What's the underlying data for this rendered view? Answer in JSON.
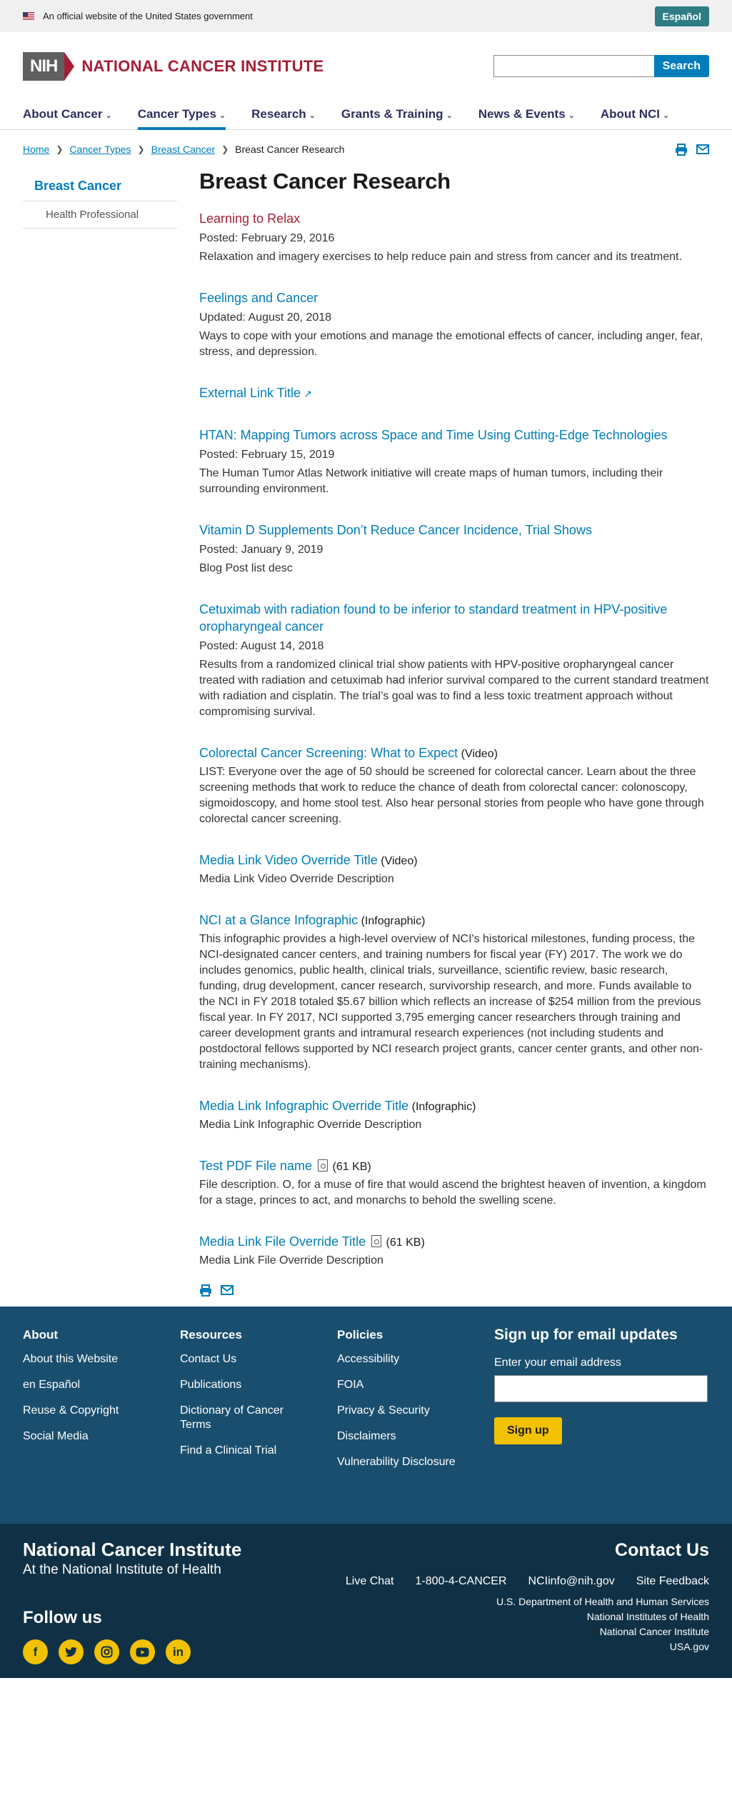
{
  "gov_banner": {
    "text": "An official website of the United States government",
    "espanol": "Español"
  },
  "header": {
    "logo_abbr": "NIH",
    "logo_title": "NATIONAL CANCER INSTITUTE",
    "search_placeholder": "",
    "search_label": "Search"
  },
  "nav": [
    {
      "label": "About Cancer",
      "active": false
    },
    {
      "label": "Cancer Types",
      "active": true
    },
    {
      "label": "Research",
      "active": false
    },
    {
      "label": "Grants & Training",
      "active": false
    },
    {
      "label": "News & Events",
      "active": false
    },
    {
      "label": "About NCI",
      "active": false
    }
  ],
  "breadcrumb": {
    "items": [
      "Home",
      "Cancer Types",
      "Breast Cancer"
    ],
    "current": "Breast Cancer Research"
  },
  "sidebar": {
    "title": "Breast Cancer",
    "items": [
      "Health Professional"
    ]
  },
  "page": {
    "title": "Breast Cancer Research"
  },
  "items": [
    {
      "title": "Learning to Relax",
      "date": "Posted: February 29, 2016",
      "desc": "Relaxation and imagery exercises to help reduce pain and stress from cancer and its treatment."
    },
    {
      "title": "Feelings and Cancer",
      "date": "Updated: August 20, 2018",
      "desc": "Ways to cope with your emotions and manage the emotional effects of cancer, including anger, fear, stress, and depression."
    },
    {
      "title": "External Link Title"
    },
    {
      "title": "HTAN: Mapping Tumors across Space and Time Using Cutting-Edge Technologies",
      "date": "Posted: February 15, 2019",
      "desc": "The Human Tumor Atlas Network initiative will create maps of human tumors, including their surrounding environment."
    },
    {
      "title": "Vitamin D Supplements Don’t Reduce Cancer Incidence, Trial Shows",
      "date": "Posted: January 9, 2019",
      "desc": "Blog Post list desc"
    },
    {
      "title": "Cetuximab with radiation found to be inferior to standard treatment in HPV-positive oropharyngeal cancer",
      "date": "Posted: August 14, 2018",
      "desc": "Results from a randomized clinical trial show patients with HPV-positive oropharyngeal cancer treated with radiation and cetuximab had inferior survival compared to the current standard treatment with radiation and cisplatin. The trial’s goal was to find a less toxic treatment approach without compromising survival."
    },
    {
      "title": "Colorectal Cancer Screening: What to Expect",
      "kind": "(Video)",
      "desc": "LIST: Everyone over the age of 50 should be screened for colorectal cancer. Learn about the three screening methods that work to reduce the chance of death from colorectal cancer: colonoscopy, sigmoidoscopy, and home stool test. Also hear personal stories from people who have gone through colorectal cancer screening."
    },
    {
      "title": "Media Link Video Override Title",
      "kind": "(Video)",
      "desc": "Media Link Video Override Description"
    },
    {
      "title": "NCI at a Glance Infographic",
      "kind": "(Infographic)",
      "desc": "This infographic provides a high-level overview of NCI's historical milestones, funding process, the NCI-designated cancer centers, and training numbers for fiscal year (FY) 2017. The work we do includes genomics, public health, clinical trials, surveillance, scientific review, basic research, funding, drug development, cancer research, survivorship research, and more. Funds available to the NCI in FY 2018 totaled $5.67 billion which reflects an increase of $254 million from the previous fiscal year. In FY 2017, NCI supported 3,795 emerging cancer researchers through training and career development grants and intramural research experiences (not including students and postdoctoral fellows supported by NCI research project grants, cancer center grants, and other non-training mechanisms)."
    },
    {
      "title": "Media Link Infographic Override Title",
      "kind": "(Infographic)",
      "desc": "Media Link Infographic Override Description"
    },
    {
      "title": "Test PDF File name",
      "size": "(61 KB)",
      "desc": "File description. O, for a muse of fire that would ascend the brightest heaven of invention, a kingdom for a stage, princes to act, and monarchs to behold the swelling scene."
    },
    {
      "title": "Media Link File Override Title",
      "size": "(61 KB)",
      "desc": "Media Link File Override Description"
    }
  ],
  "footer": {
    "about": {
      "heading": "About",
      "links": [
        "About this Website",
        "en Español",
        "Reuse & Copyright",
        "Social Media"
      ]
    },
    "resources": {
      "heading": "Resources",
      "links": [
        "Contact Us",
        "Publications",
        "Dictionary of Cancer Terms",
        "Find a Clinical Trial"
      ]
    },
    "policies": {
      "heading": "Policies",
      "links": [
        "Accessibility",
        "FOIA",
        "Privacy & Security",
        "Disclaimers",
        "Vulnerability Disclosure"
      ]
    },
    "signup": {
      "heading": "Sign up for email updates",
      "label": "Enter your email address",
      "button": "Sign up"
    }
  },
  "footer_bottom": {
    "brand_line1": "National Cancer Institute",
    "brand_line2": "At the National Institute of Health",
    "contact_heading": "Contact Us",
    "contact_links": [
      "Live Chat",
      "1-800-4-CANCER",
      "NCIinfo@nih.gov",
      "Site Feedback"
    ],
    "follow": "Follow us",
    "socials": [
      "facebook-icon",
      "twitter-icon",
      "instagram-icon",
      "youtube-icon",
      "linkedin-icon"
    ],
    "agencies": [
      "U.S. Department of Health and Human Services",
      "National Institutes of Health",
      "National Cancer Institute",
      "USA.gov"
    ]
  },
  "colors": {
    "brand_red": "#a51e36",
    "link_blue": "#007cbb",
    "footer": "#1a4e6e",
    "footer_dark": "#103145",
    "accent_yellow": "#f2c100"
  }
}
